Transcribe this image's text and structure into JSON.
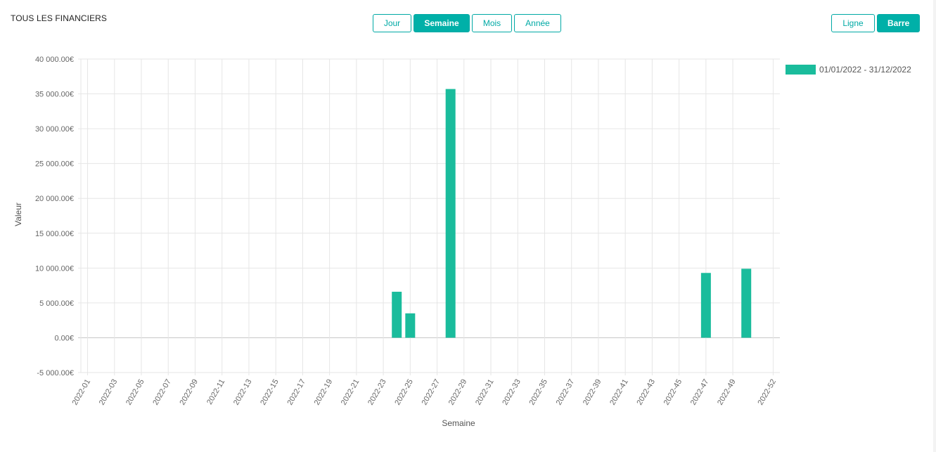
{
  "header": {
    "title": "TOUS LES FINANCIERS",
    "period_buttons": [
      {
        "label": "Jour",
        "active": false
      },
      {
        "label": "Semaine",
        "active": true
      },
      {
        "label": "Mois",
        "active": false
      },
      {
        "label": "Année",
        "active": false
      }
    ],
    "type_buttons": [
      {
        "label": "Ligne",
        "active": false
      },
      {
        "label": "Barre",
        "active": true
      }
    ]
  },
  "colors": {
    "accent": "#00a9a5",
    "bar": "#1abc9c",
    "grid": "#e6e6e6",
    "zero_line": "#c8c8c8"
  },
  "chart_data": {
    "type": "bar",
    "xlabel": "Semaine",
    "ylabel": "Valeur",
    "ylim": [
      -5000,
      40000
    ],
    "yticks": [
      40000,
      35000,
      30000,
      25000,
      20000,
      15000,
      10000,
      5000,
      0,
      -5000
    ],
    "ytick_labels": [
      "40 000.00€",
      "35 000.00€",
      "30 000.00€",
      "25 000.00€",
      "20 000.00€",
      "15 000.00€",
      "10 000.00€",
      "5 000.00€",
      "0.00€",
      "-5 000.00€"
    ],
    "xtick_labels": [
      "2022-01",
      "2022-03",
      "2022-05",
      "2022-07",
      "2022-09",
      "2022-11",
      "2022-13",
      "2022-15",
      "2022-17",
      "2022-19",
      "2022-21",
      "2022-23",
      "2022-25",
      "2022-27",
      "2022-29",
      "2022-31",
      "2022-33",
      "2022-35",
      "2022-37",
      "2022-39",
      "2022-41",
      "2022-43",
      "2022-45",
      "2022-47",
      "2022-49",
      "2022-52"
    ],
    "grid": true,
    "legend_position": "right",
    "series": [
      {
        "name": "01/01/2022 - 31/12/2022",
        "color": "#1abc9c",
        "points": [
          {
            "x": "2022-24",
            "y": 6600
          },
          {
            "x": "2022-25",
            "y": 3500
          },
          {
            "x": "2022-28",
            "y": 35700
          },
          {
            "x": "2022-47",
            "y": 9300
          },
          {
            "x": "2022-50",
            "y": 9900
          }
        ]
      }
    ]
  }
}
